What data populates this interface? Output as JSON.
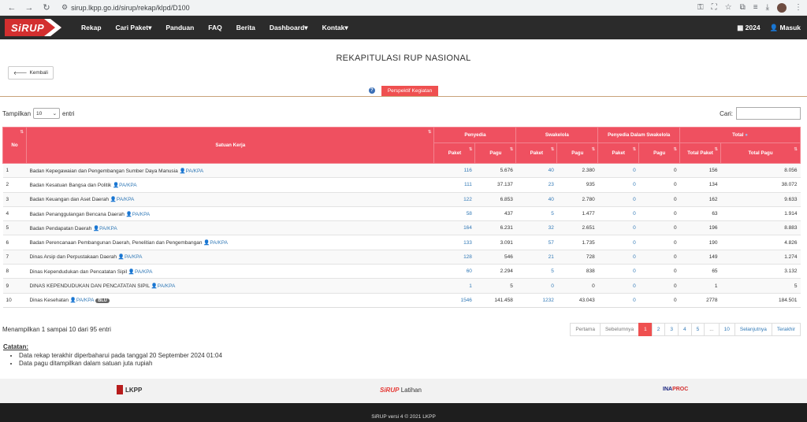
{
  "browser": {
    "url": "sirup.lkpp.go.id/sirup/rekap/klpd/D100"
  },
  "nav": {
    "logo": "SiRUP",
    "menu": [
      {
        "label": "Rekap",
        "caret": ""
      },
      {
        "label": "Cari Paket",
        "caret": "▾"
      },
      {
        "label": "Panduan",
        "caret": ""
      },
      {
        "label": "FAQ",
        "caret": ""
      },
      {
        "label": "Berita",
        "caret": ""
      },
      {
        "label": "Dashboard",
        "caret": "▾"
      },
      {
        "label": "Kontak",
        "caret": "▾"
      }
    ],
    "year": "2024",
    "login": "Masuk"
  },
  "page": {
    "title": "REKAPITULASI RUP NASIONAL",
    "back": "Kembali",
    "tab_active": "Perspektif Kegiatan"
  },
  "controls": {
    "show_prefix": "Tampilkan",
    "show_value": "10",
    "show_suffix": "entri",
    "search_label": "Cari:"
  },
  "table": {
    "headers": {
      "no": "No",
      "satker": "Satuan Kerja",
      "penyedia": "Penyedia",
      "swakelola": "Swakelola",
      "pds": "Penyedia Dalam Swakelola",
      "total": "Total",
      "paket": "Paket",
      "pagu": "Pagu",
      "total_paket": "Total Paket",
      "total_pagu": "Total Pagu"
    },
    "pa_label": "PA/KPA",
    "blu_label": "BLU",
    "rows": [
      {
        "no": "1",
        "name": "Badan Kepegawaian dan Pengembangan Sumber Daya Manusia",
        "p_paket": "116",
        "p_pagu": "5.676",
        "s_paket": "40",
        "s_pagu": "2.380",
        "d_paket": "0",
        "d_pagu": "0",
        "t_paket": "156",
        "t_pagu": "8.056",
        "blu": false
      },
      {
        "no": "2",
        "name": "Badan Kesatuan Bangsa dan Politik",
        "p_paket": "111",
        "p_pagu": "37.137",
        "s_paket": "23",
        "s_pagu": "935",
        "d_paket": "0",
        "d_pagu": "0",
        "t_paket": "134",
        "t_pagu": "38.072",
        "blu": false
      },
      {
        "no": "3",
        "name": "Badan Keuangan dan Aset Daerah",
        "p_paket": "122",
        "p_pagu": "6.853",
        "s_paket": "40",
        "s_pagu": "2.780",
        "d_paket": "0",
        "d_pagu": "0",
        "t_paket": "162",
        "t_pagu": "9.633",
        "blu": false
      },
      {
        "no": "4",
        "name": "Badan Penanggulangan Bencana Daerah",
        "p_paket": "58",
        "p_pagu": "437",
        "s_paket": "5",
        "s_pagu": "1.477",
        "d_paket": "0",
        "d_pagu": "0",
        "t_paket": "63",
        "t_pagu": "1.914",
        "blu": false
      },
      {
        "no": "5",
        "name": "Badan Pendapatan Daerah",
        "p_paket": "164",
        "p_pagu": "6.231",
        "s_paket": "32",
        "s_pagu": "2.651",
        "d_paket": "0",
        "d_pagu": "0",
        "t_paket": "196",
        "t_pagu": "8.883",
        "blu": false
      },
      {
        "no": "6",
        "name": "Badan Perencanaan Pembangunan Daerah, Penelitian dan Pengembangan",
        "p_paket": "133",
        "p_pagu": "3.091",
        "s_paket": "57",
        "s_pagu": "1.735",
        "d_paket": "0",
        "d_pagu": "0",
        "t_paket": "190",
        "t_pagu": "4.826",
        "blu": false
      },
      {
        "no": "7",
        "name": "Dinas Arsip dan Perpustakaan Daerah",
        "p_paket": "128",
        "p_pagu": "546",
        "s_paket": "21",
        "s_pagu": "728",
        "d_paket": "0",
        "d_pagu": "0",
        "t_paket": "149",
        "t_pagu": "1.274",
        "blu": false
      },
      {
        "no": "8",
        "name": "Dinas Kependudukan dan Pencatatan Sipil",
        "p_paket": "60",
        "p_pagu": "2.294",
        "s_paket": "5",
        "s_pagu": "838",
        "d_paket": "0",
        "d_pagu": "0",
        "t_paket": "65",
        "t_pagu": "3.132",
        "blu": false
      },
      {
        "no": "9",
        "name": "DINAS KEPENDUDUKAN DAN PENCATATAN SIPIL",
        "p_paket": "1",
        "p_pagu": "5",
        "s_paket": "0",
        "s_pagu": "0",
        "d_paket": "0",
        "d_pagu": "0",
        "t_paket": "1",
        "t_pagu": "5",
        "blu": false
      },
      {
        "no": "10",
        "name": "Dinas Kesehatan",
        "p_paket": "1546",
        "p_pagu": "141.458",
        "s_paket": "1232",
        "s_pagu": "43.043",
        "d_paket": "0",
        "d_pagu": "0",
        "t_paket": "2778",
        "t_pagu": "184.501",
        "blu": true
      }
    ]
  },
  "footer_table": {
    "info": "Menampilkan 1 sampai 10 dari 95 entri",
    "pager": [
      "Pertama",
      "Sebelumnya",
      "1",
      "2",
      "3",
      "4",
      "5",
      "...",
      "10",
      "Selanjutnya",
      "Terakhir"
    ],
    "pager_active": "1"
  },
  "notes": {
    "title": "Catatan:",
    "items": [
      "Data rekap terakhir diperbaharui pada tanggal 20 September 2024 01:04",
      "Data pagu ditampilkan dalam satuan juta rupiah"
    ]
  },
  "logos": {
    "lkpp": "LKPP",
    "sirup": "SiRUP",
    "latihan": "Latihan",
    "inaproc_a": "INA",
    "inaproc_b": "PROC"
  },
  "copyright": "SiRUP versi 4 © 2021 LKPP",
  "colors": {
    "accent": "#ef5060",
    "navbar": "#2b2b2b",
    "link": "#337ab7"
  }
}
